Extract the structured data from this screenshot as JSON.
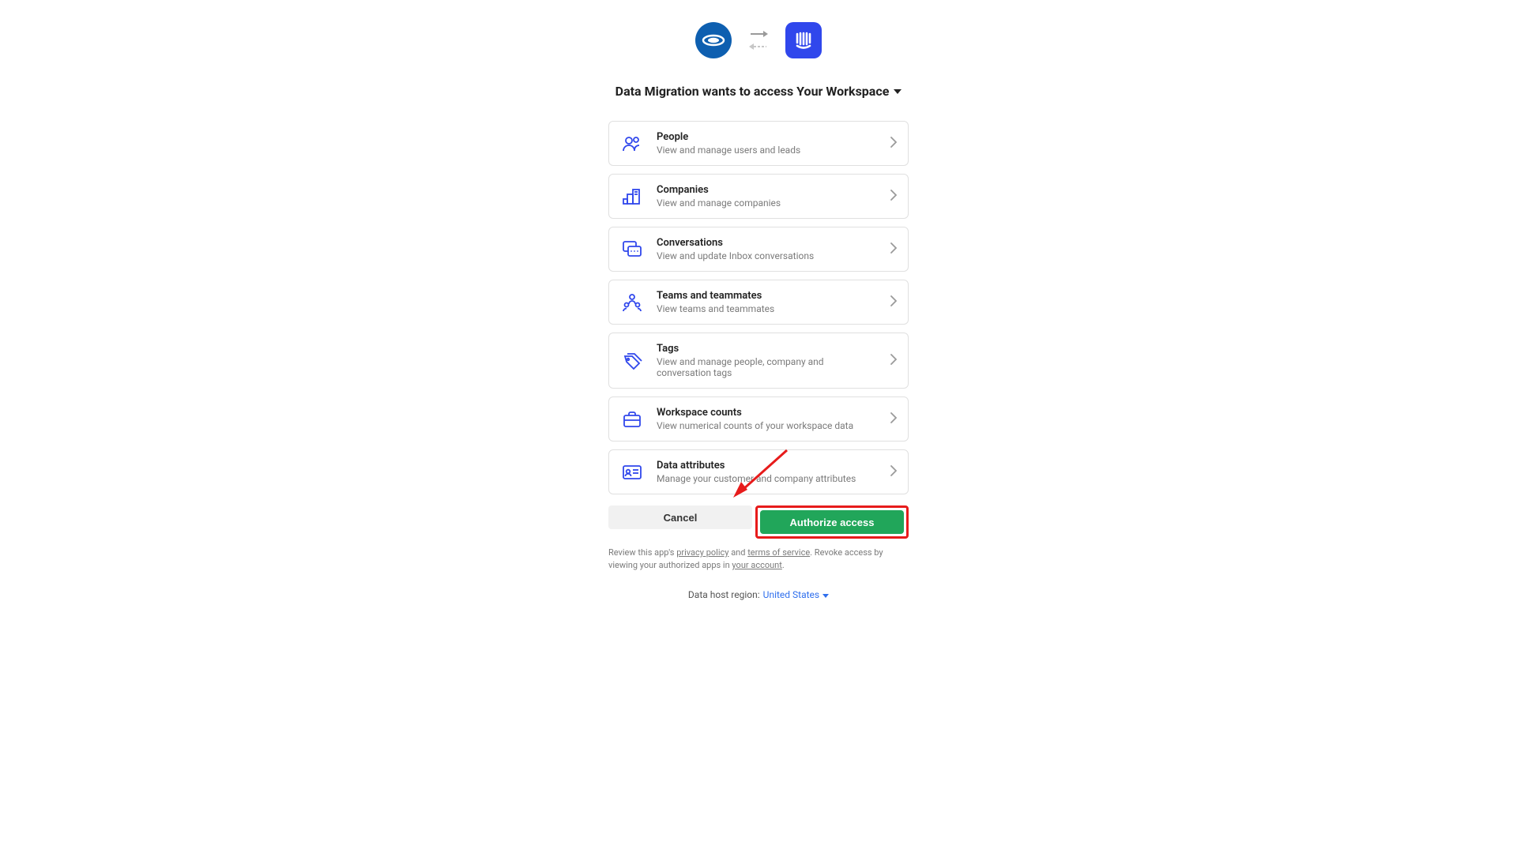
{
  "headline": "Data Migration wants to access Your Workspace",
  "permissions": [
    {
      "title": "People",
      "desc": "View and manage users and leads"
    },
    {
      "title": "Companies",
      "desc": "View and manage companies"
    },
    {
      "title": "Conversations",
      "desc": "View and update Inbox conversations"
    },
    {
      "title": "Teams and teammates",
      "desc": "View teams and teammates"
    },
    {
      "title": "Tags",
      "desc": "View and manage people, company and conversation tags"
    },
    {
      "title": "Workspace counts",
      "desc": "View numerical counts of your workspace data"
    },
    {
      "title": "Data attributes",
      "desc": "Manage your customer and company attributes"
    }
  ],
  "buttons": {
    "cancel": "Cancel",
    "authorize": "Authorize access"
  },
  "legal": {
    "pre": "Review this app's ",
    "privacy": "privacy policy",
    "mid1": " and ",
    "terms": "terms of service",
    "mid2": ". Revoke access by viewing your authorized apps in ",
    "account": "your account",
    "post": "."
  },
  "region": {
    "label": "Data host region:",
    "value": "United States"
  }
}
